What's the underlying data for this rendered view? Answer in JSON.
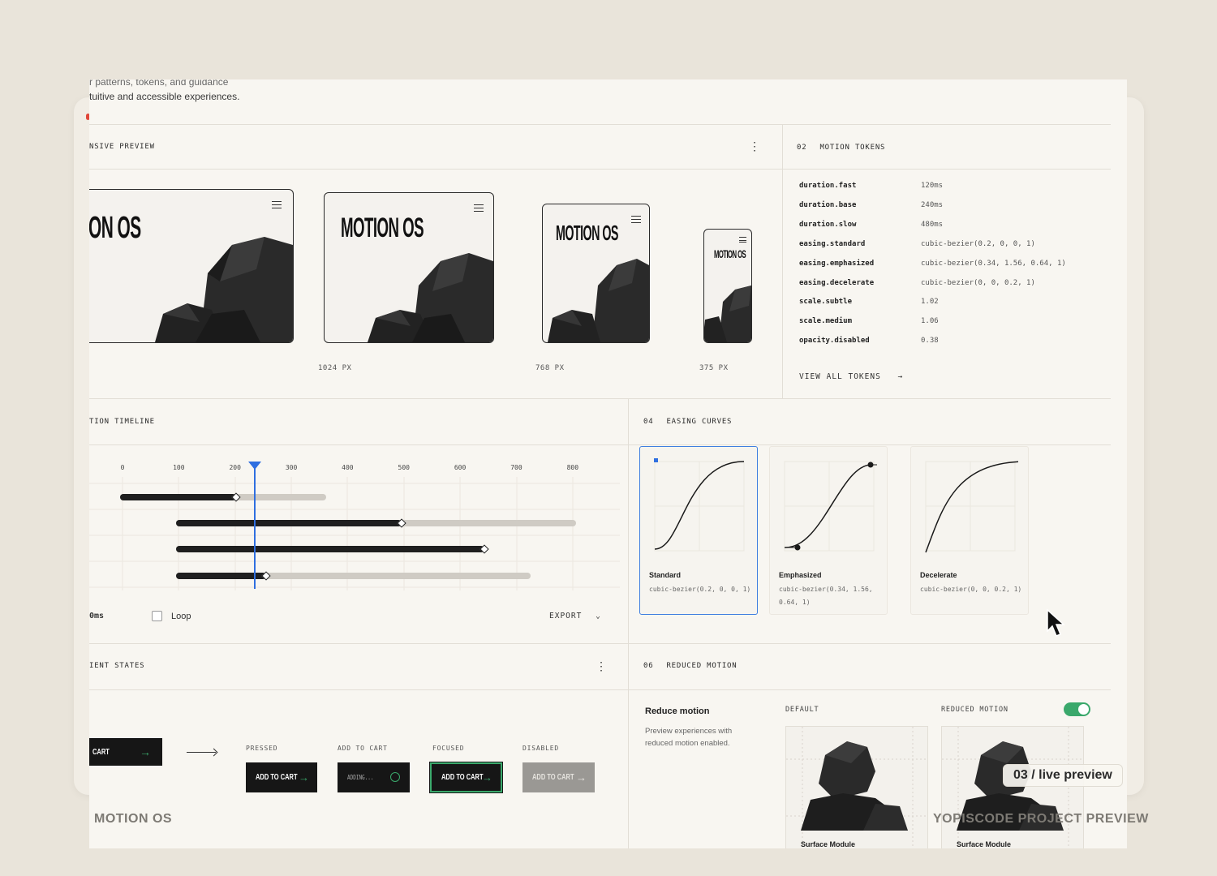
{
  "intro": {
    "line1": "r patterns, tokens, and guidance",
    "line2": "tuitive and accessible experiences."
  },
  "responsive_preview": {
    "title": "NSIVE PREVIEW",
    "devices": [
      {
        "brand": "ON OS",
        "label": ""
      },
      {
        "brand": "MOTION OS",
        "label": "1024 PX"
      },
      {
        "brand": "MOTION OS",
        "label": "768 PX"
      },
      {
        "brand": "MOTION OS",
        "label": "375 PX"
      }
    ]
  },
  "motion_tokens": {
    "num": "02",
    "title": "MOTION TOKENS",
    "tokens": [
      {
        "name": "duration.fast",
        "value": "120ms"
      },
      {
        "name": "duration.base",
        "value": "240ms"
      },
      {
        "name": "duration.slow",
        "value": "480ms"
      },
      {
        "name": "easing.standard",
        "value": "cubic-bezier(0.2, 0, 0, 1)"
      },
      {
        "name": "easing.emphasized",
        "value": "cubic-bezier(0.34, 1.56, 0.64, 1)"
      },
      {
        "name": "easing.decelerate",
        "value": "cubic-bezier(0, 0, 0.2, 1)"
      },
      {
        "name": "scale.subtle",
        "value": "1.02"
      },
      {
        "name": "scale.medium",
        "value": "1.06"
      },
      {
        "name": "opacity.disabled",
        "value": "0.38"
      }
    ],
    "view_all": "VIEW ALL TOKENS",
    "view_all_arrow": "→"
  },
  "timeline": {
    "title": "TION TIMELINE",
    "ticks": [
      "0",
      "100",
      "200",
      "300",
      "400",
      "500",
      "600",
      "700",
      "800"
    ],
    "time_readout": "0ms",
    "loop_label": "Loop",
    "export_label": "EXPORT",
    "playhead_ms": 235,
    "bars": [
      {
        "start": 0,
        "end": 366,
        "progress": 206
      },
      {
        "start": 100,
        "end": 810,
        "progress": 500
      },
      {
        "start": 100,
        "end": 648,
        "progress": 648
      },
      {
        "start": 100,
        "end": 730,
        "progress": 260
      }
    ]
  },
  "easing_curves": {
    "num": "04",
    "title": "EASING CURVES",
    "curves": [
      {
        "name": "Standard",
        "value": "cubic-bezier(0.2, 0, 0, 1)"
      },
      {
        "name": "Emphasized",
        "value": "cubic-bezier(0.34, 1.56, 0.64, 1)"
      },
      {
        "name": "Decelerate",
        "value": "cubic-bezier(0, 0, 0.2, 1)"
      }
    ]
  },
  "component_states": {
    "title": "IENT STATES",
    "main_button": "CART",
    "states": [
      {
        "label": "PRESSED",
        "button": "ADD TO CART"
      },
      {
        "label": "ADD TO CART",
        "button": "ADDING..."
      },
      {
        "label": "FOCUSED",
        "button": "ADD TO CART"
      },
      {
        "label": "DISABLED",
        "button": "ADD TO CART"
      }
    ]
  },
  "reduced_motion": {
    "num": "06",
    "title": "REDUCED MOTION",
    "heading": "Reduce motion",
    "description": "Preview experiences with reduced motion enabled.",
    "default_label": "DEFAULT",
    "reduced_label": "REDUCED MOTION",
    "toggle_on": true,
    "cards": [
      "Surface Module",
      "Surface Module"
    ]
  },
  "captions": {
    "left": "MOTION OS",
    "right": "YOPISCODE PROJECT PREVIEW",
    "badge": "03 / live preview"
  },
  "colors": {
    "accent_blue": "#2f6fe0",
    "toggle_green": "#3aa86b",
    "focus_green": "#3aa86b",
    "background": "#e9e4da"
  }
}
